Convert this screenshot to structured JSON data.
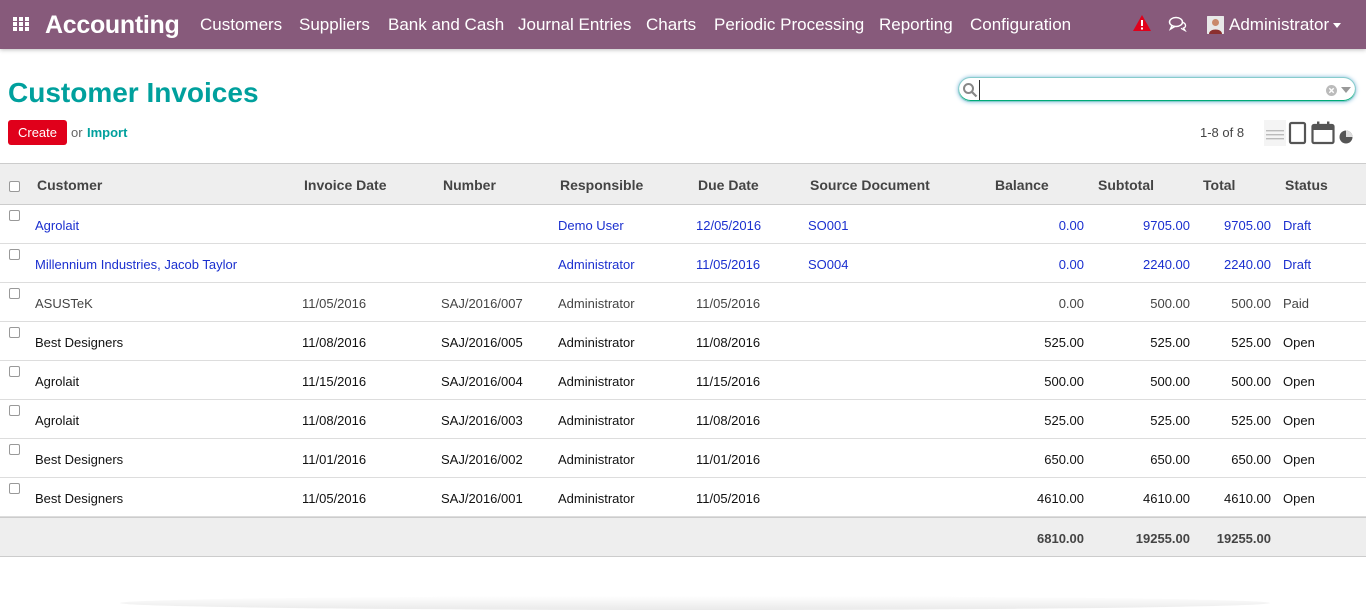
{
  "navbar": {
    "brand": "Accounting",
    "menu": [
      "Customers",
      "Suppliers",
      "Bank and Cash",
      "Journal Entries",
      "Charts",
      "Periodic Processing",
      "Reporting",
      "Configuration"
    ],
    "user": "Administrator",
    "icons": [
      "apps-icon",
      "warning-icon",
      "chat-icon",
      "avatar"
    ]
  },
  "control_panel": {
    "title": "Customer Invoices",
    "create_label": "Create",
    "or_text": "or",
    "import_label": "Import",
    "search_placeholder": "",
    "pager": "1-8 of 8"
  },
  "table": {
    "headers": [
      "Customer",
      "Invoice Date",
      "Number",
      "Responsible",
      "Due Date",
      "Source Document",
      "Balance",
      "Subtotal",
      "Total",
      "Status"
    ],
    "rows": [
      {
        "customer": "Agrolait",
        "invoice_date": "",
        "number": "",
        "responsible": "Demo User",
        "due_date": "12/05/2016",
        "source": "SO001",
        "balance": "0.00",
        "subtotal": "9705.00",
        "total": "9705.00",
        "status": "Draft"
      },
      {
        "customer": "Millennium Industries, Jacob Taylor",
        "invoice_date": "",
        "number": "",
        "responsible": "Administrator",
        "due_date": "11/05/2016",
        "source": "SO004",
        "balance": "0.00",
        "subtotal": "2240.00",
        "total": "2240.00",
        "status": "Draft"
      },
      {
        "customer": "ASUSTeK",
        "invoice_date": "11/05/2016",
        "number": "SAJ/2016/007",
        "responsible": "Administrator",
        "due_date": "11/05/2016",
        "source": "",
        "balance": "0.00",
        "subtotal": "500.00",
        "total": "500.00",
        "status": "Paid"
      },
      {
        "customer": "Best Designers",
        "invoice_date": "11/08/2016",
        "number": "SAJ/2016/005",
        "responsible": "Administrator",
        "due_date": "11/08/2016",
        "source": "",
        "balance": "525.00",
        "subtotal": "525.00",
        "total": "525.00",
        "status": "Open"
      },
      {
        "customer": "Agrolait",
        "invoice_date": "11/15/2016",
        "number": "SAJ/2016/004",
        "responsible": "Administrator",
        "due_date": "11/15/2016",
        "source": "",
        "balance": "500.00",
        "subtotal": "500.00",
        "total": "500.00",
        "status": "Open"
      },
      {
        "customer": "Agrolait",
        "invoice_date": "11/08/2016",
        "number": "SAJ/2016/003",
        "responsible": "Administrator",
        "due_date": "11/08/2016",
        "source": "",
        "balance": "525.00",
        "subtotal": "525.00",
        "total": "525.00",
        "status": "Open"
      },
      {
        "customer": "Best Designers",
        "invoice_date": "11/01/2016",
        "number": "SAJ/2016/002",
        "responsible": "Administrator",
        "due_date": "11/01/2016",
        "source": "",
        "balance": "650.00",
        "subtotal": "650.00",
        "total": "650.00",
        "status": "Open"
      },
      {
        "customer": "Best Designers",
        "invoice_date": "11/05/2016",
        "number": "SAJ/2016/001",
        "responsible": "Administrator",
        "due_date": "11/05/2016",
        "source": "",
        "balance": "4610.00",
        "subtotal": "4610.00",
        "total": "4610.00",
        "status": "Open"
      }
    ],
    "totals": {
      "balance": "6810.00",
      "subtotal": "19255.00",
      "total": "19255.00"
    }
  },
  "colors": {
    "navbar": "#875a7b",
    "title": "#00a09d",
    "create_button": "#e0001b",
    "draft_text": "#1a2fcf"
  }
}
